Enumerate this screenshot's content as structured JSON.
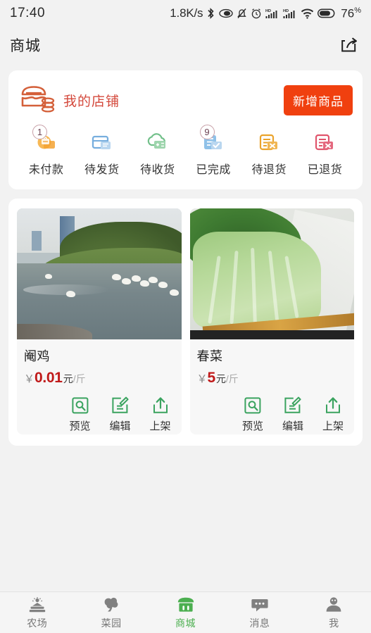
{
  "statusbar": {
    "time": "17:40",
    "network_speed": "1.8K/s",
    "icons": [
      "bluetooth-icon",
      "data-saver-icon",
      "mute-icon",
      "alarm-icon",
      "hd-signal-one-icon",
      "hd-signal-two-icon",
      "wifi-icon",
      "battery-icon"
    ],
    "battery_percent": "76",
    "percent_sign": "%"
  },
  "titlebar": {
    "title": "商城",
    "share_icon": "share-icon"
  },
  "shop": {
    "icon": "storefront-icon",
    "name": "我的店铺",
    "add_product_label": "新增商品",
    "accent_color": "#f0400f",
    "name_color": "#d4493c",
    "stats": [
      {
        "label": "未付款",
        "icon": "unpaid-coin-icon",
        "badge": "1",
        "color": "#f5a623"
      },
      {
        "label": "待发货",
        "icon": "to-ship-box-icon",
        "badge": "",
        "color": "#5b9bd5"
      },
      {
        "label": "待收货",
        "icon": "to-receive-icon",
        "badge": "",
        "color": "#54b06a"
      },
      {
        "label": "已完成",
        "icon": "completed-doc-icon",
        "badge": "9",
        "color": "#5b9bd5"
      },
      {
        "label": "待退货",
        "icon": "pending-return-icon",
        "badge": "",
        "color": "#eaa32c"
      },
      {
        "label": "已退货",
        "icon": "returned-icon",
        "badge": "",
        "color": "#e0556c"
      }
    ]
  },
  "products": [
    {
      "image": "river-ducks-photo",
      "title": "阉鸡",
      "currency": "￥",
      "amount": "0.01",
      "yuan": "元",
      "unit": "/斤",
      "actions": [
        {
          "label": "预览",
          "icon": "preview-icon"
        },
        {
          "label": "编辑",
          "icon": "edit-icon"
        },
        {
          "label": "上架",
          "icon": "publish-icon"
        }
      ]
    },
    {
      "image": "green-vegetable-photo",
      "title": "春菜",
      "currency": "￥",
      "amount": "5",
      "yuan": "元",
      "unit": "/斤",
      "actions": [
        {
          "label": "预览",
          "icon": "preview-icon"
        },
        {
          "label": "编辑",
          "icon": "edit-icon"
        },
        {
          "label": "上架",
          "icon": "publish-icon"
        }
      ]
    }
  ],
  "bottomnav": {
    "active_color": "#4caf50",
    "inactive_color": "#777777",
    "items": [
      {
        "label": "农场",
        "icon": "farm-icon",
        "active": false
      },
      {
        "label": "菜园",
        "icon": "garden-tree-icon",
        "active": false
      },
      {
        "label": "商城",
        "icon": "store-icon",
        "active": true
      },
      {
        "label": "消息",
        "icon": "message-icon",
        "active": false
      },
      {
        "label": "我",
        "icon": "profile-icon",
        "active": false
      }
    ]
  }
}
